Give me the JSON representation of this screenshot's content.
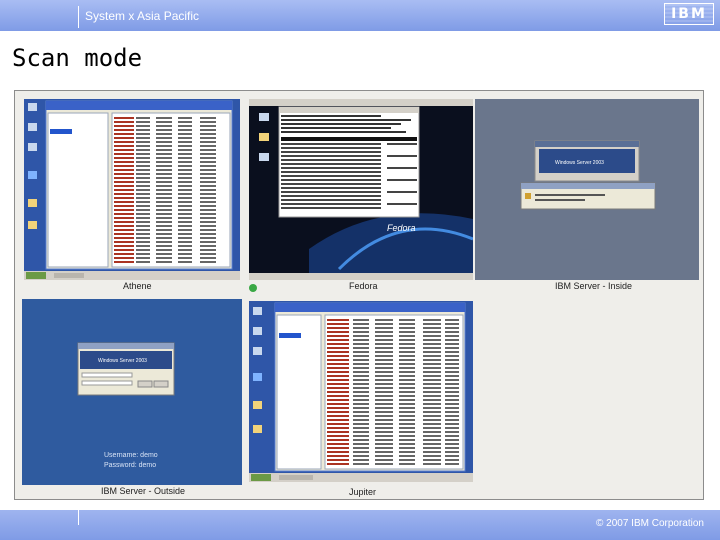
{
  "header": {
    "title": "System x Asia Pacific",
    "logo": "IBM"
  },
  "slide": {
    "title": "Scan mode"
  },
  "screens": [
    {
      "caption": "Athene",
      "desktop_icons": [
        "computer-icon",
        "network-icon",
        "recycle-bin-icon",
        "ie-icon",
        "folder-icon",
        "folder-icon"
      ]
    },
    {
      "caption": "Fedora",
      "wallpaper_text": "Fedora",
      "desktop_icons": [
        "computer-icon",
        "home-icon",
        "trash-icon"
      ]
    },
    {
      "caption": "IBM Server - Inside",
      "login_banner": "Windows Server 2003"
    },
    {
      "caption": "IBM Server - Outside",
      "login_banner": "Windows Server 2003",
      "desktop_lines": [
        "Username: demo",
        "Password: demo"
      ]
    },
    {
      "caption": "Jupiter",
      "desktop_icons": [
        "computer-icon",
        "network-icon",
        "recycle-bin-icon",
        "ie-icon",
        "folder-icon",
        "folder-icon"
      ]
    }
  ],
  "indicator_color": "#3aa845",
  "footer": {
    "copyright": "© 2007 IBM Corporation"
  },
  "colors": {
    "header": "#8aa4ea",
    "desktop": "#2f56a8",
    "fedora": "#0a0f1e"
  }
}
